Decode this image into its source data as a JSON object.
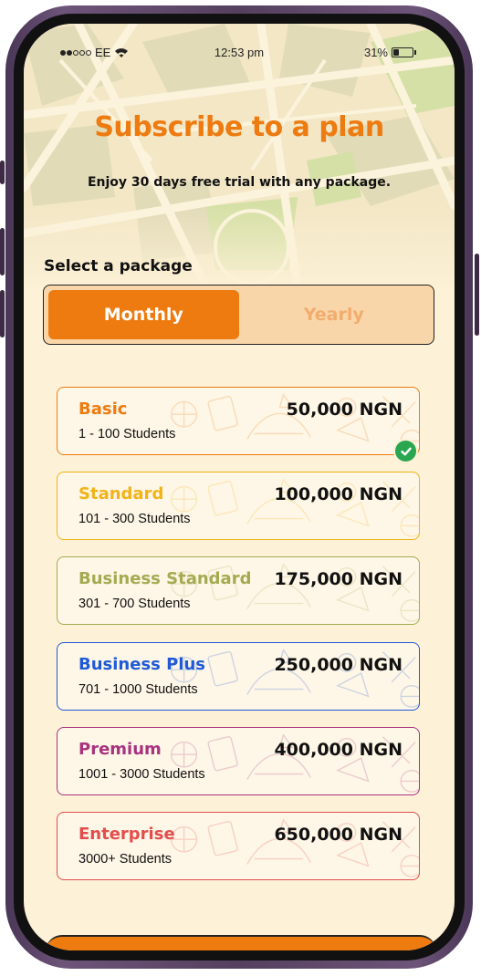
{
  "status_bar": {
    "carrier": "EE",
    "time": "12:53 pm",
    "battery": "31%",
    "battery_level": 0.31
  },
  "header": {
    "title": "Subscribe to a plan",
    "subtitle": "Enjoy 30 days free trial with any package."
  },
  "package_section": {
    "label": "Select a package",
    "tabs": [
      {
        "label": "Monthly",
        "selected": true
      },
      {
        "label": "Yearly",
        "selected": false
      }
    ]
  },
  "plans": [
    {
      "name": "Basic",
      "range": "1 - 100 Students",
      "price": "50,000 NGN",
      "color": "#ee7b10",
      "selected": true
    },
    {
      "name": "Standard",
      "range": "101 - 300 Students",
      "price": "100,000 NGN",
      "color": "#f2b318",
      "selected": false
    },
    {
      "name": "Business Standard",
      "range": "301 - 700 Students",
      "price": "175,000 NGN",
      "color": "#a3ab51",
      "selected": false
    },
    {
      "name": "Business Plus",
      "range": "701 - 1000 Students",
      "price": "250,000 NGN",
      "color": "#1f5ad6",
      "selected": false
    },
    {
      "name": "Premium",
      "range": "1001 - 3000 Students",
      "price": "400,000 NGN",
      "color": "#a8327f",
      "selected": false
    },
    {
      "name": "Enterprise",
      "range": "3000+ Students",
      "price": "650,000 NGN",
      "color": "#e34d4d",
      "selected": false
    }
  ],
  "icons": {
    "wifi": "wifi-icon",
    "battery": "battery-icon",
    "check": "check-circle-icon",
    "signal": "signal-dots-icon"
  }
}
